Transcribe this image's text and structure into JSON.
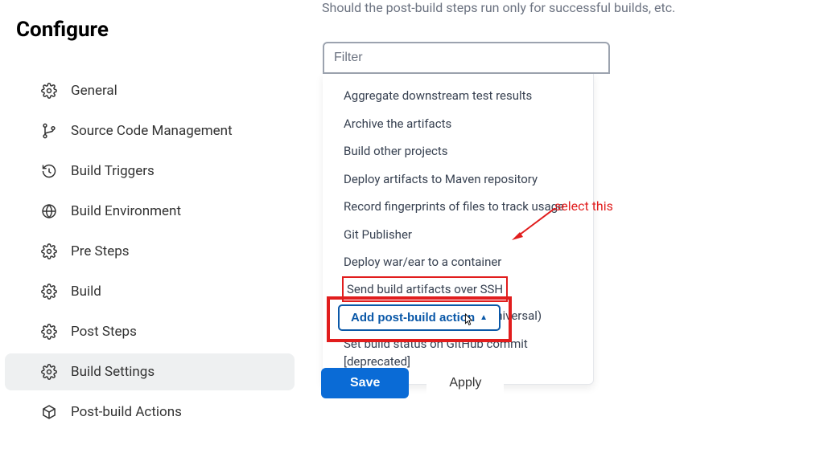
{
  "page": {
    "title": "Configure",
    "hint": "Should the post-build steps run only for successful builds, etc."
  },
  "sidebar": {
    "items": [
      {
        "label": "General"
      },
      {
        "label": "Source Code Management"
      },
      {
        "label": "Build Triggers"
      },
      {
        "label": "Build Environment"
      },
      {
        "label": "Pre Steps"
      },
      {
        "label": "Build"
      },
      {
        "label": "Post Steps"
      },
      {
        "label": "Build Settings"
      },
      {
        "label": "Post-build Actions"
      }
    ]
  },
  "filter": {
    "placeholder": "Filter"
  },
  "dropdown": {
    "items": [
      "Aggregate downstream test results",
      "Archive the artifacts",
      "Build other projects",
      "Deploy artifacts to Maven repository",
      "Record fingerprints of files to track usage",
      "Git Publisher",
      "Deploy war/ear to a container",
      "Send build artifacts over SSH",
      "Set GitHub commit status (universal)",
      "Set build status on GitHub commit [deprecated]"
    ]
  },
  "add_action": {
    "label": "Add post-build action"
  },
  "annotation": {
    "text": "select this"
  },
  "buttons": {
    "save": "Save",
    "apply": "Apply"
  }
}
